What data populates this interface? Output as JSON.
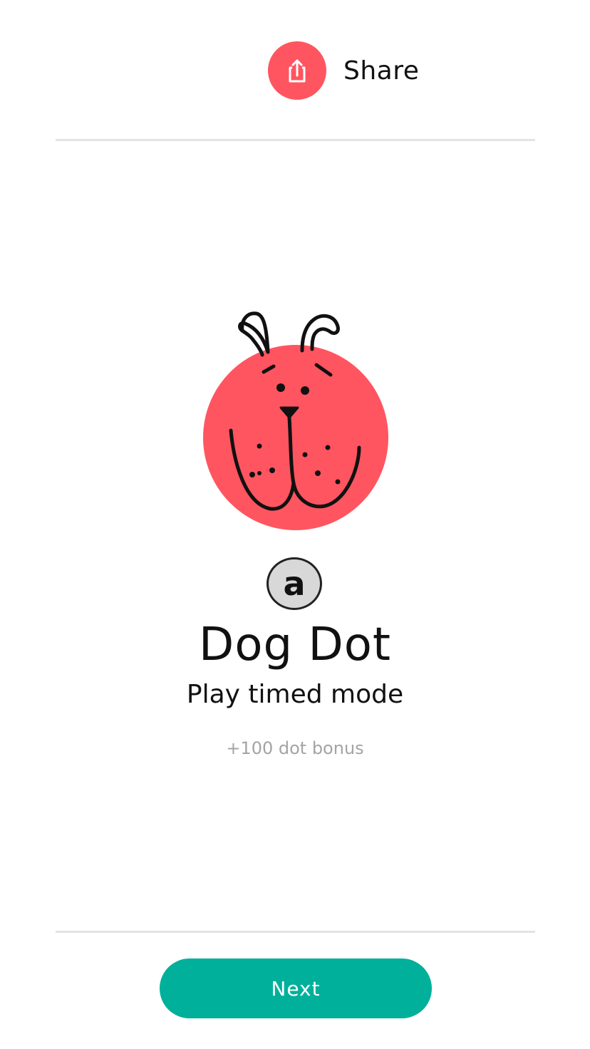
{
  "share": {
    "label": "Share",
    "icon": "share-icon",
    "color": "#ff5560"
  },
  "level": {
    "badge": "a",
    "title": "Dog Dot",
    "subtitle": "Play timed mode",
    "bonus": "+100 dot bonus",
    "character_icon": "dog-face",
    "character_color": "#ff5560"
  },
  "footer": {
    "next_label": "Next",
    "next_color": "#00b09b"
  }
}
